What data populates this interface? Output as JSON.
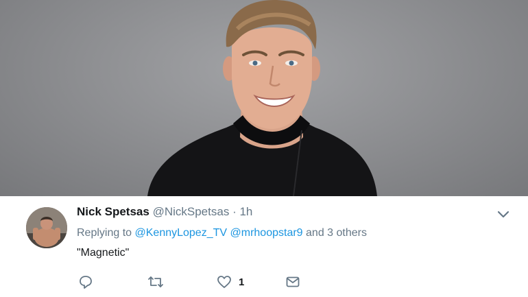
{
  "tweet": {
    "display_name": "Nick Spetsas",
    "handle": "@NickSpetsas",
    "separator": "·",
    "time": "1h",
    "replying_prefix": "Replying to",
    "mention_1": "@KennyLopez_TV",
    "mention_2": "@mrhoopstar9",
    "replying_suffix": "and 3 others",
    "text": "\"Magnetic\"",
    "like_count": "1"
  },
  "icons": {
    "menu": "chevron-down-icon",
    "reply": "reply-icon",
    "retweet": "retweet-icon",
    "like": "heart-icon",
    "message": "direct-message-icon"
  },
  "colors": {
    "link": "#1b95e0",
    "secondary_text": "#657786",
    "primary_text": "#14171a",
    "photo_background": "#8f9093"
  }
}
